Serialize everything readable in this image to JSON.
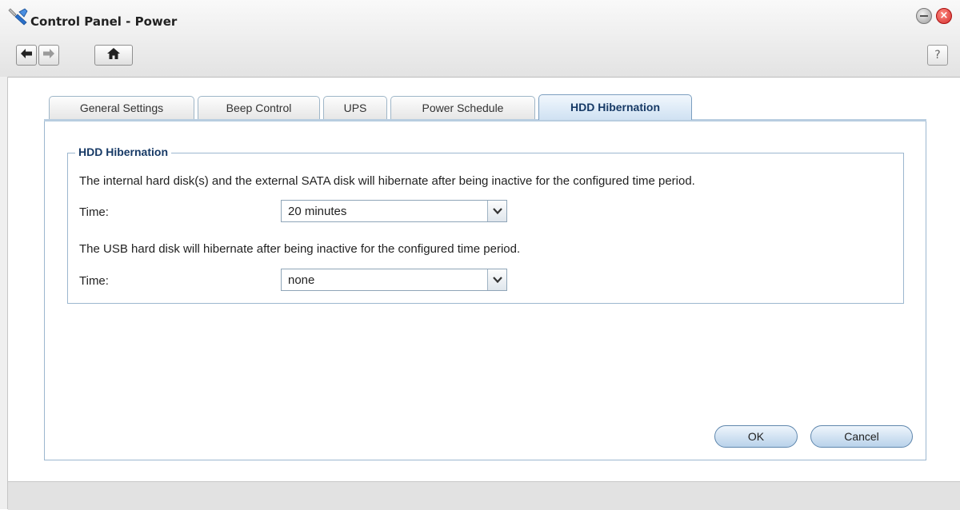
{
  "window": {
    "title": "Control Panel - Power",
    "icon": "control-panel-tools-icon"
  },
  "toolbar": {
    "back_icon": "arrow-left-icon",
    "forward_icon": "arrow-right-icon",
    "home_icon": "home-icon",
    "help_label": "?"
  },
  "window_controls": {
    "close_label": "×"
  },
  "tabs": [
    {
      "label": "General Settings",
      "active": false
    },
    {
      "label": "Beep Control",
      "active": false
    },
    {
      "label": "UPS",
      "active": false
    },
    {
      "label": "Power Schedule",
      "active": false
    },
    {
      "label": "HDD Hibernation",
      "active": true
    }
  ],
  "hibernation": {
    "group_title": "HDD Hibernation",
    "internal_desc": "The internal hard disk(s) and the external SATA disk will hibernate after being inactive for the configured time period.",
    "internal_time_label": "Time:",
    "internal_time_value": "20 minutes",
    "usb_desc": "The USB hard disk will hibernate after being inactive for the configured time period.",
    "usb_time_label": "Time:",
    "usb_time_value": "none"
  },
  "actions": {
    "ok_label": "OK",
    "cancel_label": "Cancel"
  },
  "colors": {
    "accent": "#173a66",
    "tab_active": "#cfe1f2",
    "border": "#9cb7cf",
    "close": "#d32f2f"
  }
}
